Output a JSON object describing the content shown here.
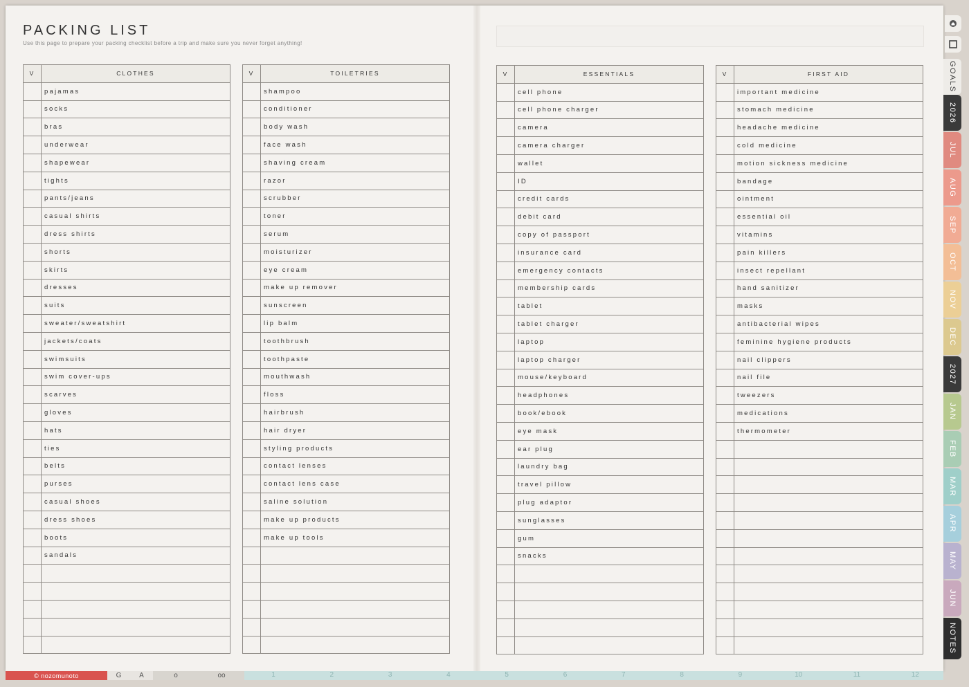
{
  "page": {
    "title": "PACKING LIST",
    "subtitle": "Use this page to prepare your packing checklist before a trip and make sure you never forget anything!"
  },
  "check_header": "V",
  "lists": [
    {
      "header": "CLOTHES",
      "items": [
        "pajamas",
        "socks",
        "bras",
        "underwear",
        "shapewear",
        "tights",
        "pants/jeans",
        "casual shirts",
        "dress shirts",
        "shorts",
        "skirts",
        "dresses",
        "suits",
        "sweater/sweatshirt",
        "jackets/coats",
        "swimsuits",
        "swim cover-ups",
        "scarves",
        "gloves",
        "hats",
        "ties",
        "belts",
        "purses",
        "casual shoes",
        "dress shoes",
        "boots",
        "sandals",
        "",
        "",
        "",
        "",
        ""
      ]
    },
    {
      "header": "TOILETRIES",
      "items": [
        "shampoo",
        "conditioner",
        "body wash",
        "face wash",
        "shaving cream",
        "razor",
        "scrubber",
        "toner",
        "serum",
        "moisturizer",
        "eye cream",
        "make up remover",
        "sunscreen",
        "lip balm",
        "toothbrush",
        "toothpaste",
        "mouthwash",
        "floss",
        "hairbrush",
        "hair dryer",
        "styling products",
        "contact lenses",
        "contact lens case",
        "saline solution",
        "make up products",
        "make up tools",
        "",
        "",
        "",
        "",
        "",
        ""
      ]
    },
    {
      "header": "ESSENTIALS",
      "items": [
        "cell phone",
        "cell phone charger",
        "camera",
        "camera charger",
        "wallet",
        "ID",
        "credit cards",
        "debit card",
        "copy of passport",
        "insurance card",
        "emergency contacts",
        "membership cards",
        "tablet",
        "tablet charger",
        "laptop",
        "laptop charger",
        "mouse/keyboard",
        "headphones",
        "book/ebook",
        "eye mask",
        "ear plug",
        "laundry bag",
        "travel pillow",
        "plug adaptor",
        "sunglasses",
        "gum",
        "snacks",
        "",
        "",
        "",
        "",
        ""
      ]
    },
    {
      "header": "FIRST AID",
      "items": [
        "important medicine",
        "stomach medicine",
        "headache medicine",
        "cold medicine",
        "motion sickness medicine",
        "bandage",
        "ointment",
        "essential oil",
        "vitamins",
        "pain killers",
        "insect repellant",
        "hand sanitizer",
        "masks",
        "antibacterial wipes",
        "feminine hygiene products",
        "nail clippers",
        "nail file",
        "tweezers",
        "medications",
        "thermometer",
        "",
        "",
        "",
        "",
        "",
        "",
        "",
        "",
        "",
        "",
        "",
        ""
      ]
    }
  ],
  "side_tabs": [
    {
      "label": "GOALS",
      "color": "#eeece8",
      "text": "#444"
    },
    {
      "label": "2026",
      "color": "#3a3a3a",
      "text": "#ffffff"
    },
    {
      "label": "JUL",
      "color": "#e08a80",
      "text": "#ffffff"
    },
    {
      "label": "AUG",
      "color": "#ec9a8c",
      "text": "#ffffff"
    },
    {
      "label": "SEP",
      "color": "#f1ab94",
      "text": "#ffffff"
    },
    {
      "label": "OCT",
      "color": "#f3be96",
      "text": "#ffffff"
    },
    {
      "label": "NOV",
      "color": "#eccf96",
      "text": "#ffffff"
    },
    {
      "label": "DEC",
      "color": "#dcc98f",
      "text": "#ffffff"
    },
    {
      "label": "2027",
      "color": "#3a3a3a",
      "text": "#ffffff"
    },
    {
      "label": "JAN",
      "color": "#b7c98f",
      "text": "#ffffff"
    },
    {
      "label": "FEB",
      "color": "#a9cdb4",
      "text": "#ffffff"
    },
    {
      "label": "MAR",
      "color": "#9fcfc9",
      "text": "#ffffff"
    },
    {
      "label": "APR",
      "color": "#a6cfdc",
      "text": "#ffffff"
    },
    {
      "label": "MAY",
      "color": "#b9b2cf",
      "text": "#ffffff"
    },
    {
      "label": "JUN",
      "color": "#c9a9bd",
      "text": "#ffffff"
    },
    {
      "label": "NOTES",
      "color": "#2e2e2e",
      "text": "#ffffff"
    }
  ],
  "bottom_bar": {
    "brand": "© nozomunoto",
    "segments": [
      "G",
      "A",
      "o",
      "oo"
    ],
    "numbers": [
      "1",
      "2",
      "3",
      "4",
      "5",
      "6",
      "7",
      "8",
      "9",
      "10",
      "11",
      "12"
    ]
  },
  "icons": [
    "home-icon",
    "square-icon"
  ]
}
